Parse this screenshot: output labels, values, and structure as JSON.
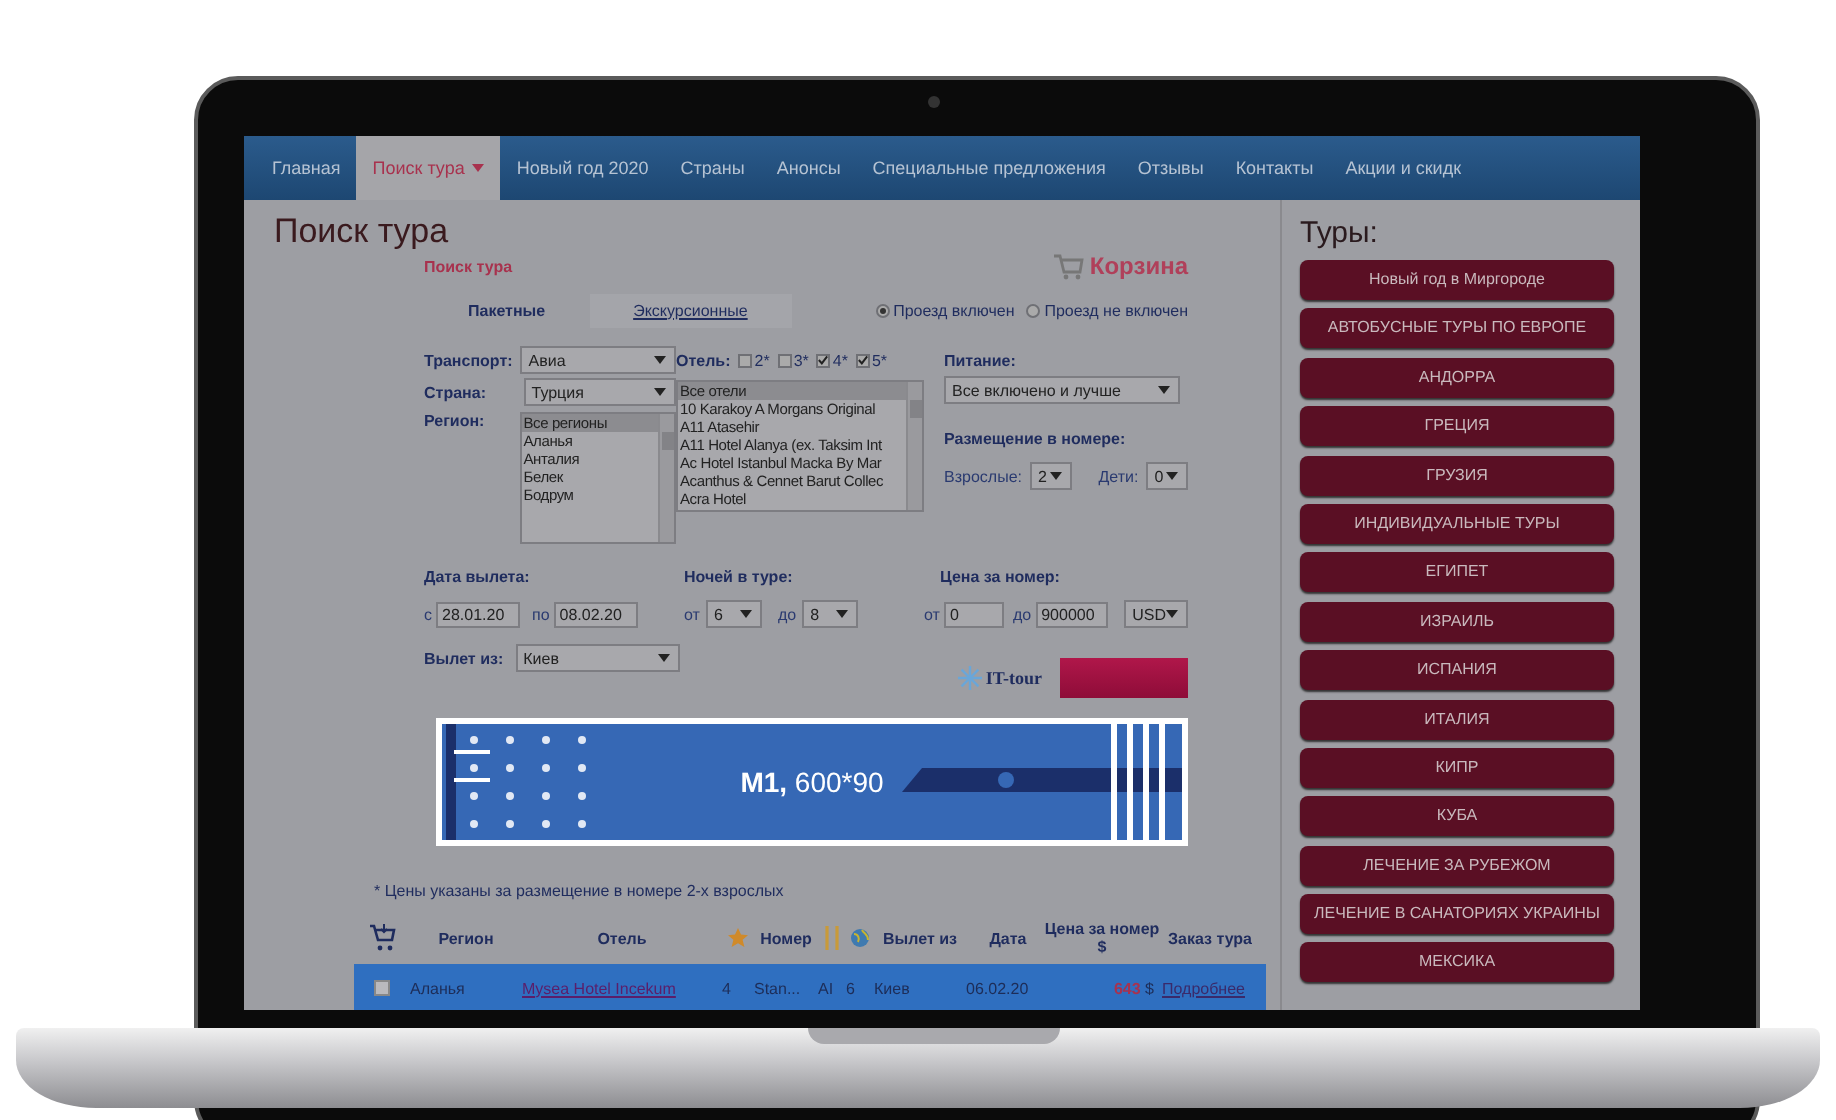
{
  "nav": [
    {
      "label": "Главная",
      "selected": false,
      "dropdown": false
    },
    {
      "label": "Поиск тура",
      "selected": true,
      "dropdown": true
    },
    {
      "label": "Новый год 2020",
      "selected": false,
      "dropdown": false
    },
    {
      "label": "Страны",
      "selected": false,
      "dropdown": false
    },
    {
      "label": "Анонсы",
      "selected": false,
      "dropdown": false
    },
    {
      "label": "Специальные предложения",
      "selected": false,
      "dropdown": false
    },
    {
      "label": "Отзывы",
      "selected": false,
      "dropdown": false
    },
    {
      "label": "Контакты",
      "selected": false,
      "dropdown": false
    },
    {
      "label": "Акции и скидк",
      "selected": false,
      "dropdown": false
    }
  ],
  "page_title": "Поиск тура",
  "form_title": "Поиск тура",
  "cart": "Корзина",
  "tour_types": [
    {
      "label": "Пакетные",
      "selected": true
    },
    {
      "label": "Экскурсионные",
      "selected": false
    }
  ],
  "travel_options": [
    {
      "label": "Проезд включен",
      "selected": true
    },
    {
      "label": "Проезд не включен",
      "selected": false
    }
  ],
  "transport": {
    "label": "Транспорт:",
    "value": "Авиа"
  },
  "country": {
    "label": "Страна:",
    "value": "Турция"
  },
  "region": {
    "label": "Регион:",
    "items": [
      {
        "label": "Все регионы",
        "selected": true
      },
      {
        "label": "Аланья",
        "selected": false
      },
      {
        "label": "Анталия",
        "selected": false
      },
      {
        "label": "Белек",
        "selected": false
      },
      {
        "label": "Бодрум",
        "selected": false
      }
    ]
  },
  "hotel": {
    "label": "Отель:",
    "stars": [
      {
        "label": "2*",
        "checked": false
      },
      {
        "label": "3*",
        "checked": false
      },
      {
        "label": "4*",
        "checked": true
      },
      {
        "label": "5*",
        "checked": true
      }
    ],
    "items": [
      {
        "label": "Все отели",
        "selected": true
      },
      {
        "label": "10 Karakoy A Morgans Original",
        "selected": false
      },
      {
        "label": "A11 Atasehir",
        "selected": false
      },
      {
        "label": "A11 Hotel Alanya (ex. Taksim Int",
        "selected": false
      },
      {
        "label": "Ac Hotel Istanbul Macka By Mar",
        "selected": false
      },
      {
        "label": "Acanthus & Cennet Barut Collec",
        "selected": false
      },
      {
        "label": "Acra Hotel",
        "selected": false
      }
    ]
  },
  "meal": {
    "label": "Питание:",
    "value": "Все включено и лучше"
  },
  "accommodation": {
    "label": "Размещение в номере:",
    "adults_label": "Взрослые:",
    "adults": "2",
    "children_label": "Дети:",
    "children": "0"
  },
  "dates": {
    "label": "Дата вылета:",
    "from_label": "с",
    "from": "28.01.20",
    "to_label": "по",
    "to": "08.02.20"
  },
  "nights": {
    "label": "Ночей в туре:",
    "from_label": "от",
    "from": "6",
    "to_label": "до",
    "to": "8"
  },
  "price": {
    "label": "Цена за номер:",
    "from_label": "от",
    "from": "0",
    "to_label": "до",
    "to": "900000",
    "currency": "USD"
  },
  "departure": {
    "label": "Вылет из:",
    "value": "Киев"
  },
  "provider_logo": "IT-tour",
  "banner": "**M1,** 600*90",
  "note": "* Цены указаны за размещение в номере 2-х взрослых",
  "results": {
    "columns": [
      "Регион",
      "Отель",
      "Номер",
      "Вылет из",
      "Дата",
      "Цена за номер",
      "$",
      "Заказ тура"
    ],
    "rows": [
      {
        "selected": true,
        "checked": false,
        "region": "Аланья",
        "hotel": "Mysea Hotel Incekum",
        "category": "4",
        "room": "Stan...",
        "meal": "AI",
        "nights": "6",
        "from": "Киев",
        "date": "06.02.20",
        "price": "643",
        "currency": "$",
        "action": "Подробнее"
      }
    ]
  },
  "sidebar": {
    "title": "Туры:",
    "items": [
      "Новый год в Миргороде",
      "АВТОБУСНЫЕ ТУРЫ ПО ЕВРОПЕ",
      "АНДОРРА",
      "ГРЕЦИЯ",
      "ГРУЗИЯ",
      "ИНДИВИДУАЛЬНЫЕ ТУРЫ",
      "ЕГИПЕТ",
      "ИЗРАИЛЬ",
      "ИСПАНИЯ",
      "ИТАЛИЯ",
      "КИПР",
      "КУБА",
      "ЛЕЧЕНИЕ ЗА РУБЕЖОМ",
      "ЛЕЧЕНИЕ В САНАТОРИЯХ УКРАИНЫ",
      "МЕКСИКА"
    ]
  }
}
